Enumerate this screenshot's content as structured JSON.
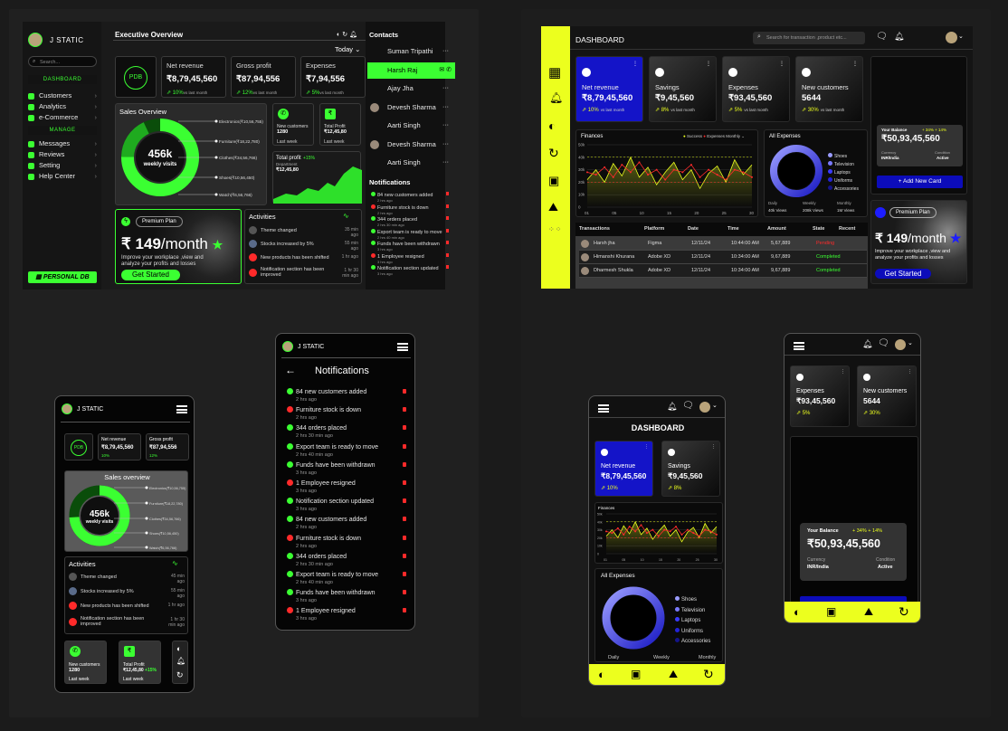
{
  "desktop_left": {
    "brand": "J STATIC",
    "search_placeholder": "Search...",
    "section_dashboard": "DASHBOARD",
    "section_manage": "MANAGE",
    "nav": [
      "Customers",
      "Analytics",
      "e-Commerce",
      "Messages",
      "Reviews",
      "Setting",
      "Help Center"
    ],
    "personal_badge": "PERSONAL DB",
    "header_title": "Executive Overview",
    "period": "Today",
    "kpis": [
      {
        "label": "Net  revenue",
        "value": "₹8,79,45,560",
        "change": "10%",
        "note": "vs last month"
      },
      {
        "label": "Gross profit",
        "value": "₹87,94,556",
        "change": "12%",
        "note": "vs last month"
      },
      {
        "label": "Expenses",
        "value": "₹7,94,556",
        "change": "5%",
        "note": "vs last month"
      }
    ],
    "logo_text": "PDB",
    "sales_title": "Sales Overview",
    "visits_value": "456k",
    "visits_label": "weekly visits",
    "donut_segments": [
      "10%",
      "15%",
      "30%",
      "10%",
      "30%",
      "5%"
    ],
    "sales_items": [
      "Electronics(₹10,56,755)",
      "Furniture(₹18,22,780)",
      "Clothes(₹34,56,766)",
      "Shoes(₹10,56,450)",
      "Watch(₹6,56,766)"
    ],
    "mini_cards": [
      {
        "label": "New customers",
        "value": "1280",
        "sub": "Last week"
      },
      {
        "label": "Total Profit",
        "value": "₹12,45,80",
        "change": "+15%",
        "sub": "Last week"
      }
    ],
    "total_profit": {
      "label": "Total profit",
      "change": "+15%",
      "sub": "Department",
      "value": "₹12,45,80"
    },
    "plan": {
      "name": "Premium Plan",
      "price": "₹ 149",
      "per": "/month",
      "desc": "Improve your  workplace ,view and analyze your profits and losses",
      "cta": "Get Started"
    },
    "activities_title": "Activities",
    "activities": [
      {
        "text": "Theme changed",
        "time": "35 min ago"
      },
      {
        "text": "Stocks increased by 5%",
        "time": "55 min ago"
      },
      {
        "text": "New products has been shifted",
        "time": "1 hr ago"
      },
      {
        "text": "Notification section has been improved",
        "time": "1 hr 30 min ago"
      }
    ],
    "contacts_title": "Contacts",
    "contacts": [
      "Suman Tripathi",
      "Harsh Raj",
      "Ajay Jha",
      "Devesh Sharma",
      "Aarti Singh",
      "Devesh Sharma",
      "Aarti Singh"
    ],
    "notifications_title": "Notifications",
    "notifications": [
      {
        "text": "84 new customers added",
        "time": "2 hrs ago",
        "color": "#3bff32"
      },
      {
        "text": "Furniture stock is down",
        "time": "2 hrs ago",
        "color": "#ff2a2a"
      },
      {
        "text": "344 orders placed",
        "time": "2 hrs 30 min ago",
        "color": "#3bff32"
      },
      {
        "text": "Export team is ready to move",
        "time": "2 hrs 40 min ago",
        "color": "#3bff32"
      },
      {
        "text": "Funds have been withdrawn",
        "time": "3 hrs ago",
        "color": "#3bff32"
      },
      {
        "text": "1  Employee resigned",
        "time": "3 hrs ago",
        "color": "#ff2a2a"
      },
      {
        "text": "Notification section updated",
        "time": "3 hrs ago",
        "color": "#3bff32"
      }
    ]
  },
  "mobile_left": {
    "brand": "J STATIC",
    "kpis": [
      {
        "label": "Net  revenue",
        "value": "₹8,79,45,560",
        "change": "10%"
      },
      {
        "label": "Gross profit",
        "value": "₹87,94,556",
        "change": "12%"
      }
    ],
    "sales_title": "Sales overview",
    "visits_value": "456k",
    "visits_label": "weekly visits",
    "sales_items": [
      "Electronics(₹10,56,755)",
      "Furniture(₹18,22,780)",
      "Clothes(₹34,56,766)",
      "Shoes(₹10,56,450)",
      "Watch(₹6,56,766)"
    ],
    "activities_title": "Activities",
    "activities": [
      {
        "text": "Theme changed",
        "time": "45 min ago"
      },
      {
        "text": "Stocks increased by 5%",
        "time": "55 min ago"
      },
      {
        "text": "New products has been shifted",
        "time": "1 hr ago"
      },
      {
        "text": "Notification section has been improved",
        "time": "1 hr 30 min ago"
      }
    ],
    "mini_cards": [
      {
        "label": "New customers",
        "value": "1280",
        "sub": "Last week"
      },
      {
        "label": "Total Profit",
        "value": "₹12,45,80",
        "change": "+15%",
        "sub": "Last week"
      }
    ]
  },
  "mobile_notif": {
    "brand": "J STATIC",
    "title": "Notifications",
    "items": [
      {
        "text": "84 new customers added",
        "time": "2 hrs ago",
        "color": "#3bff32"
      },
      {
        "text": "Furniture stock is down",
        "time": "2 hrs ago",
        "color": "#ff2a2a"
      },
      {
        "text": "344 orders placed",
        "time": "2 hrs 30 min ago",
        "color": "#3bff32"
      },
      {
        "text": "Export team is ready to move",
        "time": "2 hrs 40 min ago",
        "color": "#3bff32"
      },
      {
        "text": "Funds have been withdrawn",
        "time": "3 hrs ago",
        "color": "#3bff32"
      },
      {
        "text": "1  Employee resigned",
        "time": "3 hrs ago",
        "color": "#ff2a2a"
      },
      {
        "text": "Notification section updated",
        "time": "3 hrs ago",
        "color": "#3bff32"
      },
      {
        "text": "84 new customers added",
        "time": "2 hrs ago",
        "color": "#3bff32"
      },
      {
        "text": "Furniture stock is down",
        "time": "2 hrs ago",
        "color": "#ff2a2a"
      },
      {
        "text": "344 orders placed",
        "time": "2 hrs 30 min ago",
        "color": "#3bff32"
      },
      {
        "text": "Export team is ready to move",
        "time": "2 hrs 40 min ago",
        "color": "#3bff32"
      },
      {
        "text": "Funds have been withdrawn",
        "time": "3 hrs ago",
        "color": "#3bff32"
      },
      {
        "text": "1  Employee resigned",
        "time": "3 hrs ago",
        "color": "#ff2a2a"
      }
    ]
  },
  "desktop_right": {
    "title": "DASHBOARD",
    "search_placeholder": "Search for transaction ,product etc...",
    "kpis": [
      {
        "label": "Net  revenue",
        "value": "₹8,79,45,560",
        "change": "10%",
        "note": "vs last month"
      },
      {
        "label": "Savings",
        "value": "₹9,45,560",
        "change": "8%",
        "note": "vs last month"
      },
      {
        "label": "Expenses",
        "value": "₹93,45,560",
        "change": "5%",
        "note": "vs last month"
      },
      {
        "label": "New customers",
        "value": "5644",
        "change": "30%",
        "note": "vs last month"
      }
    ],
    "finances_title": "Finances",
    "legend": [
      "Success",
      "Expenses",
      "Monthly"
    ],
    "y_ticks": [
      "50k",
      "40k",
      "30k",
      "20k",
      "10k",
      "0"
    ],
    "x_ticks": [
      "01",
      "05",
      "10",
      "15",
      "20",
      "25",
      "30"
    ],
    "all_expenses_title": "All Expenses",
    "expense_legend": [
      "Shoes",
      "Television",
      "Laptops",
      "Uniforms",
      "Accessories"
    ],
    "views": [
      {
        "label": "Daily",
        "value": "40k Views"
      },
      {
        "label": "Weekly",
        "value": "208k Views"
      },
      {
        "label": "Monthly",
        "value": "1M Views"
      }
    ],
    "balance": {
      "label": "Your Balance",
      "changes": "+ 34%  + 14%",
      "value": "₹50,93,45,560",
      "currency_label": "Currency",
      "currency": "INR/India",
      "condition_label": "Condition",
      "condition": "Active"
    },
    "add_card": "+ Add New Card",
    "plan": {
      "name": "Premium Plan",
      "price": "₹ 149",
      "per": "/month",
      "desc": "Improve your  workplace ,view and analyze your profits and losses",
      "cta": "Get Started"
    },
    "table_headers": [
      "Transactions",
      "Platform",
      "Date",
      "Time",
      "Amount",
      "State",
      "Recent"
    ],
    "table_rows": [
      [
        "Harsh jha",
        "Figma",
        "12/11/24",
        "10:44:00 AM",
        "5,67,889",
        "Pending"
      ],
      [
        "Himanshi Khurana",
        "Adobe XD",
        "12/11/24",
        "10:34:00 AM",
        "9,67,889",
        "Completed"
      ],
      [
        "Dharmesh Shukla",
        "Adobe XD",
        "12/11/24",
        "10:34:00 AM",
        "9,67,889",
        "Completed"
      ]
    ]
  },
  "mobile_right": {
    "title": "DASHBOARD",
    "kpis": [
      {
        "label": "Net  revenue",
        "value": "₹8,79,45,560",
        "change": "10%"
      },
      {
        "label": "Savings",
        "value": "₹9,45,560",
        "change": "8%"
      }
    ],
    "finances_title": "Finances",
    "all_expenses_title": "All Expenses",
    "expense_legend": [
      "Shoes",
      "Television",
      "Laptops",
      "Uniforms",
      "Accessories"
    ],
    "views": [
      "Daily",
      "Weekly",
      "Monthly"
    ]
  },
  "mobile_right2": {
    "kpis": [
      {
        "label": "Expenses",
        "value": "₹93,45,560",
        "change": "5%"
      },
      {
        "label": "New customers",
        "value": "5644",
        "change": "30%"
      }
    ],
    "balance": {
      "label": "Your Balance",
      "changes": "+ 34%  + 14%",
      "value": "₹50,93,45,560",
      "currency_label": "Currency",
      "currency": "INR/India",
      "condition_label": "Condition",
      "condition": "Active"
    }
  },
  "colors": {
    "green": "#3bff32",
    "yellow": "#ecff1e",
    "red": "#ff2a2a",
    "blue": "#1d1dff"
  }
}
